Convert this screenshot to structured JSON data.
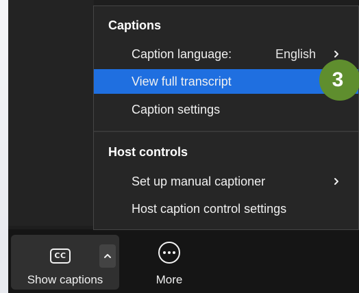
{
  "menu": {
    "captions_heading": "Captions",
    "caption_language_label": "Caption language:",
    "caption_language_value": "English",
    "view_transcript_label": "View full transcript",
    "caption_settings_label": "Caption settings",
    "host_controls_heading": "Host controls",
    "manual_captioner_label": "Set up manual captioner",
    "host_caption_settings_label": "Host caption control settings"
  },
  "toolbar": {
    "cc_icon_text": "CC",
    "show_captions_label": "Show captions",
    "more_label": "More"
  },
  "step_badge": {
    "number": "3",
    "color": "#5f8e2e"
  },
  "colors": {
    "selection": "#1f6fe0",
    "menu_background": "#262626",
    "toolbar_background": "#151515"
  },
  "icons": [
    "closed-captions-icon",
    "chevron-up-icon",
    "more-icon",
    "chevron-right-icon"
  ]
}
